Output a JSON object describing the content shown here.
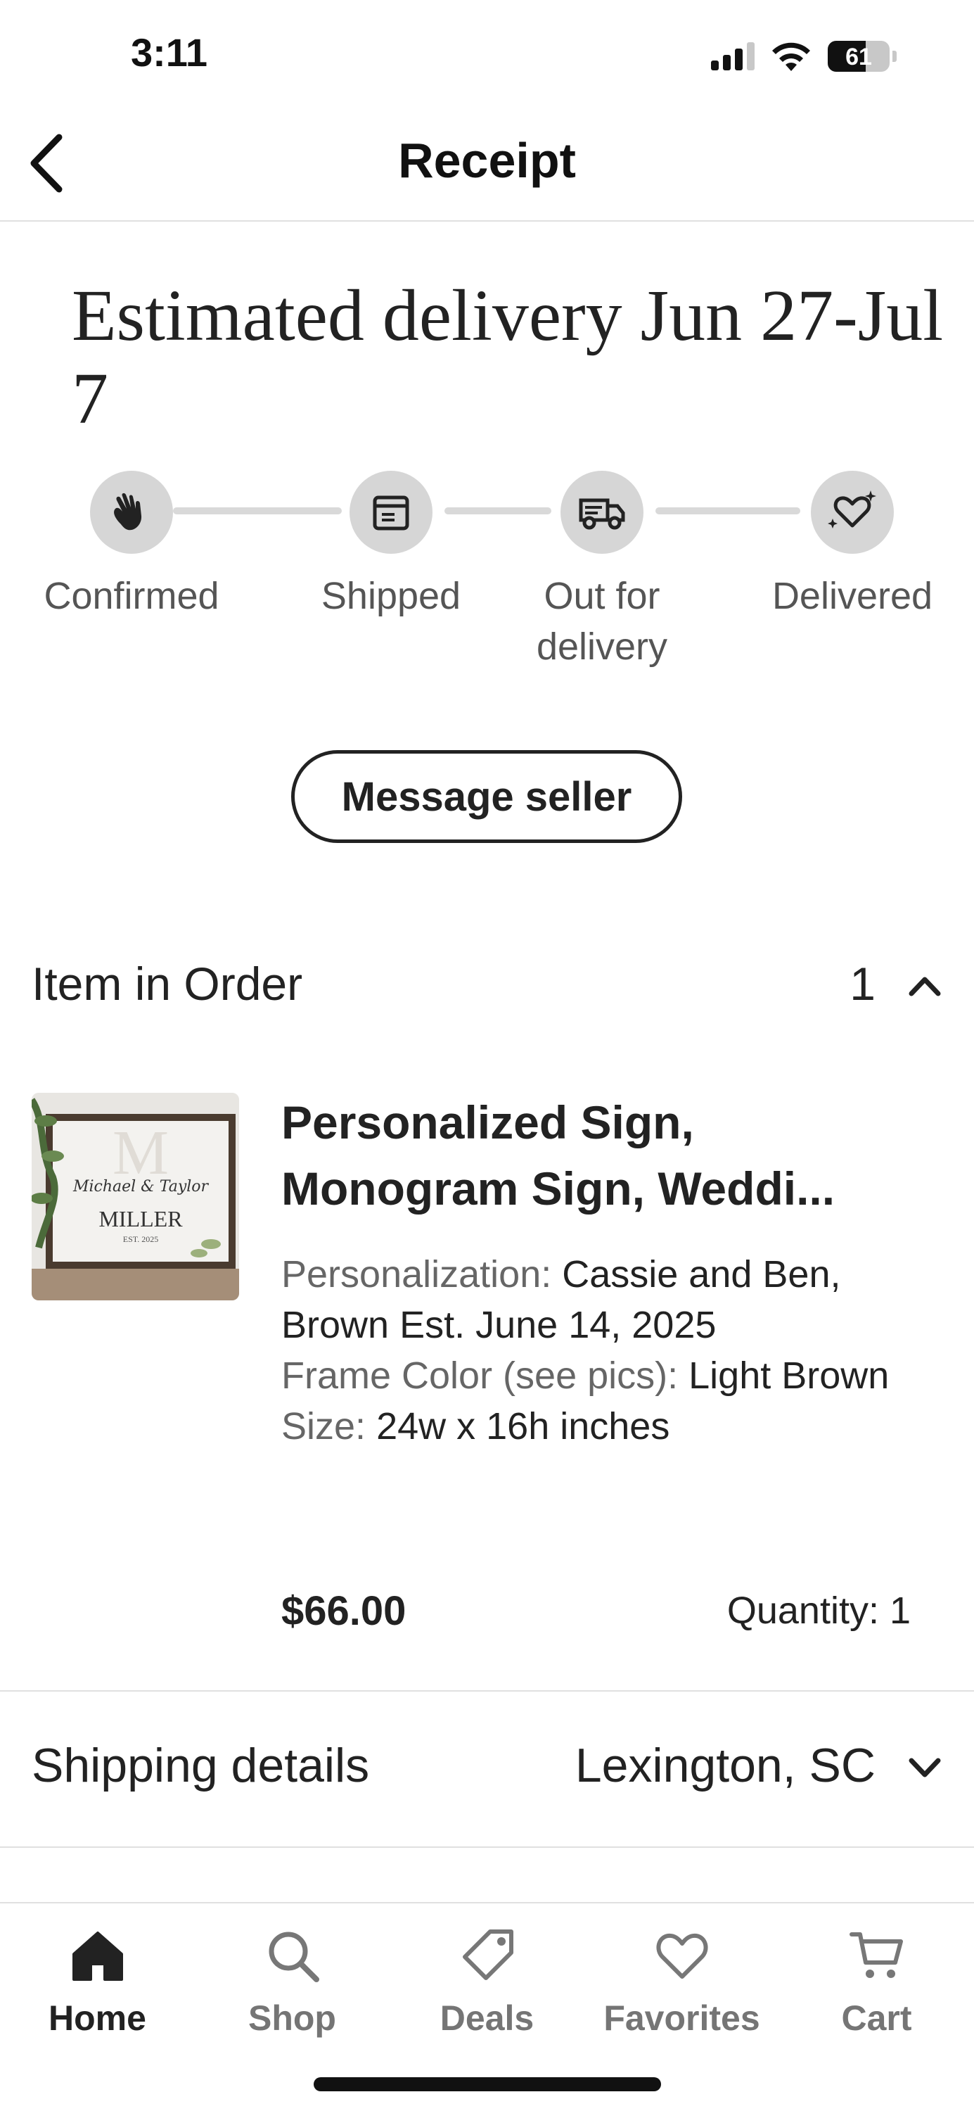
{
  "status_bar": {
    "time": "3:11",
    "battery": "61",
    "battery_level": 0.61
  },
  "nav": {
    "title": "Receipt"
  },
  "delivery": {
    "title": "Estimated delivery Jun 27-Jul 7",
    "steps": [
      {
        "label": "Confirmed",
        "icon": "hand-wave-icon"
      },
      {
        "label": "Shipped",
        "icon": "package-icon"
      },
      {
        "label": "Out for delivery",
        "icon": "delivery-truck-icon"
      },
      {
        "label": "Delivered",
        "icon": "heart-sparkle-icon"
      }
    ]
  },
  "message_seller_label": "Message seller",
  "order": {
    "section_title": "Item in Order",
    "count": "1",
    "item": {
      "title": "Personalized Sign, Monogram Sign, Weddi...",
      "thumbnail_text": {
        "script": "Michael & Taylor",
        "name": "MILLER",
        "est": "EST. 2025"
      },
      "details": [
        {
          "key": "Personalization:",
          "value": " Cassie and Ben, Brown Est. June 14, 2025"
        },
        {
          "key": "Frame Color (see pics):",
          "value": " Light Brown"
        },
        {
          "key": "Size:",
          "value": " 24w x 16h inches"
        }
      ],
      "price": "$66.00",
      "quantity": "Quantity: 1"
    }
  },
  "shipping": {
    "label": "Shipping details",
    "value": "Lexington, SC"
  },
  "tabbar": {
    "tabs": [
      {
        "label": "Home",
        "icon": "home-icon",
        "active": true
      },
      {
        "label": "Shop",
        "icon": "search-icon",
        "active": false
      },
      {
        "label": "Deals",
        "icon": "tag-icon",
        "active": false
      },
      {
        "label": "Favorites",
        "icon": "heart-icon",
        "active": false
      },
      {
        "label": "Cart",
        "icon": "cart-icon",
        "active": false
      }
    ]
  }
}
